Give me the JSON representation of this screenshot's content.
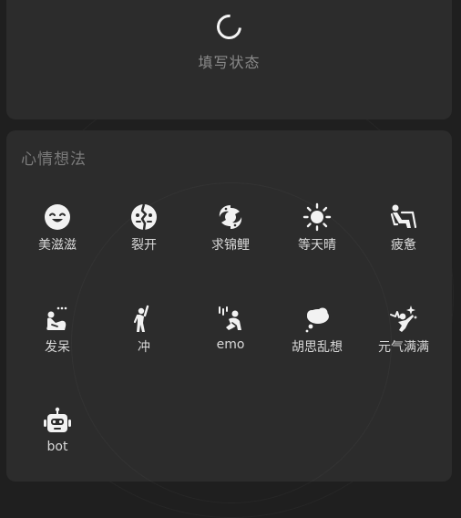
{
  "status": {
    "label": "填写状态"
  },
  "mood": {
    "title": "心情想法",
    "items": [
      {
        "label": "美滋滋",
        "icon": "smile-face-icon"
      },
      {
        "label": "裂开",
        "icon": "cracked-face-icon"
      },
      {
        "label": "求锦鲤",
        "icon": "koi-fish-icon"
      },
      {
        "label": "等天晴",
        "icon": "sun-icon"
      },
      {
        "label": "疲惫",
        "icon": "reclining-person-icon"
      },
      {
        "label": "发呆",
        "icon": "daydream-person-icon"
      },
      {
        "label": "冲",
        "icon": "cheering-person-icon"
      },
      {
        "label": "emo",
        "icon": "sad-person-rain-icon"
      },
      {
        "label": "胡思乱想",
        "icon": "thought-cloud-icon"
      },
      {
        "label": "元气满满",
        "icon": "energetic-person-icon"
      },
      {
        "label": "bot",
        "icon": "robot-icon"
      }
    ]
  }
}
